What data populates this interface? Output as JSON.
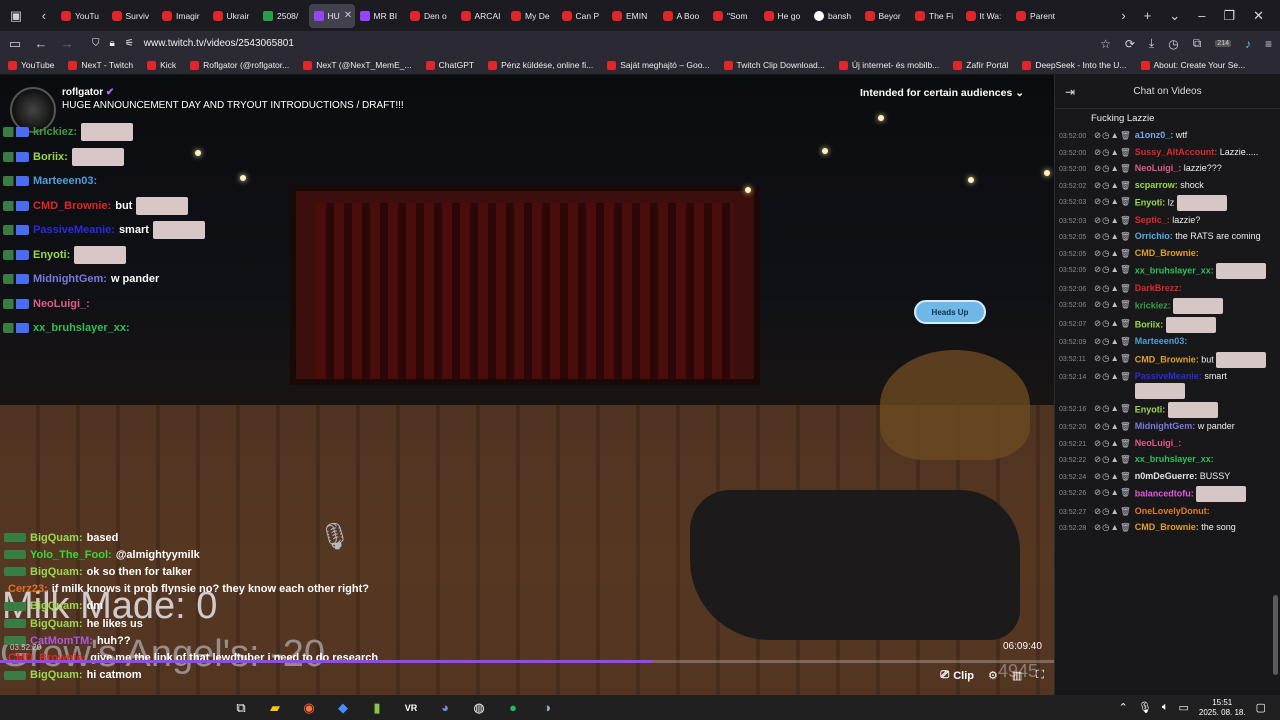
{
  "browser": {
    "tabs": [
      {
        "label": "YouTu",
        "icon": "youtube"
      },
      {
        "label": "Surviv",
        "icon": "youtube"
      },
      {
        "label": "Imagir",
        "icon": "youtube"
      },
      {
        "label": "Ukrair",
        "icon": "youtube"
      },
      {
        "label": "2508/",
        "icon": "sheet"
      },
      {
        "label": "HU",
        "icon": "twitch",
        "active": true
      },
      {
        "label": "MR BI",
        "icon": "twitch"
      },
      {
        "label": "Den o",
        "icon": "youtube"
      },
      {
        "label": "ARCAI",
        "icon": "youtube"
      },
      {
        "label": "My De",
        "icon": "youtube"
      },
      {
        "label": "Can P",
        "icon": "youtube"
      },
      {
        "label": "EMIN",
        "icon": "youtube"
      },
      {
        "label": "A Boo",
        "icon": "youtube"
      },
      {
        "label": "\"Som",
        "icon": "youtube"
      },
      {
        "label": "He go",
        "icon": "youtube"
      },
      {
        "label": "bansh",
        "icon": "google"
      },
      {
        "label": "Beyor",
        "icon": "youtube"
      },
      {
        "label": "The Fi",
        "icon": "youtube"
      },
      {
        "label": "It Wa:",
        "icon": "youtube"
      },
      {
        "label": "Parent",
        "icon": "youtube"
      }
    ],
    "url": "www.twitch.tv/videos/2543065801",
    "bookmarks": [
      "YouTube",
      "NexT - Twitch",
      "Kick",
      "Roflgator (@roflgator...",
      "NexT (@NexT_MemE_...",
      "ChatGPT",
      "Pénz küldése, online fi...",
      "Saját meghajtó – Goo...",
      "Twitch Clip Download...",
      "Új internet- és mobilb...",
      "Zafír Portál",
      "DeepSeek - Into the U...",
      "About: Create Your Se..."
    ],
    "extension_badge": "214"
  },
  "video": {
    "streamer": "roflgator",
    "title": "HUGE ANNOUNCEMENT DAY AND TRYOUT INTRODUCTIONS / DRAFT!!!",
    "audience_label": "Intended for certain audiences",
    "heads_up": "Heads Up",
    "time": "06:09:40",
    "clip_label": "Clip",
    "progress_fraction": 0.62,
    "overlay_text_1": "Milk Made: 0",
    "overlay_text_2": "Grow's Angel's: -20",
    "overlay_number": "4945",
    "overlay_chat": [
      {
        "user": "krickiez:",
        "color": "#3e9d3e",
        "text": "",
        "emote": true
      },
      {
        "user": "Boriix:",
        "color": "#9ad94f",
        "text": "",
        "emote": true
      },
      {
        "user": "Marteeen03:",
        "color": "#4f9fd9",
        "text": "",
        "emote": false
      },
      {
        "user": "CMD_Brownie:",
        "color": "#e0272a",
        "text": "but",
        "emote": true
      },
      {
        "user": "PassiveMeanie:",
        "color": "#2a2ae0",
        "text": "smart",
        "emote": true
      },
      {
        "user": "Enyoti:",
        "color": "#9ad94f",
        "text": "",
        "emote": true
      },
      {
        "user": "MidnightGem:",
        "color": "#7a7ae0",
        "text": "w pander",
        "emote": false
      },
      {
        "user": "NeoLuigi_:",
        "color": "#e05a8a",
        "text": "",
        "emote": false
      },
      {
        "user": "xx_bruhslayer_xx:",
        "color": "#2fbf5a",
        "text": "",
        "emote": false
      }
    ],
    "lower_chat": [
      {
        "user": "BigQuam:",
        "color": "#9ad94f",
        "text": "based"
      },
      {
        "user": "Yolo_The_Fool:",
        "color": "#3ad93a",
        "text": "@almightyymilk"
      },
      {
        "user": "BigQuam:",
        "color": "#9ad94f",
        "text": "ok so then for talker"
      },
      {
        "user": "Cerz23:",
        "color": "#e0702a",
        "text": "if milk knows it prob flynsie no? they know each other right?"
      },
      {
        "user": "BigQuam:",
        "color": "#9ad94f",
        "text": "dm"
      },
      {
        "user": "BigQuam:",
        "color": "#9ad94f",
        "text": "he likes us"
      },
      {
        "user": "CatMomTM:",
        "color": "#b05ae0",
        "text": "huh??"
      },
      {
        "user": "CMD_Brownie:",
        "color": "#e0272a",
        "text": "give me the link of that lewdtuber i need to do research"
      },
      {
        "user": "BigQuam:",
        "color": "#9ad94f",
        "text": "hi catmom"
      }
    ],
    "lower_timestamp": "03:52:20"
  },
  "chat": {
    "header": "Chat on Videos",
    "first_line": "Fucking Lazzie",
    "messages": [
      {
        "ts": "03:52:00",
        "user": "a1onz0_:",
        "color": "#7aa6e8",
        "text": "wtf",
        "emote": false
      },
      {
        "ts": "03:52:00",
        "user": "Sussy_AltAccount:",
        "color": "#e0272a",
        "text": "Lazzie.....",
        "emote": false
      },
      {
        "ts": "03:52:00",
        "user": "NeoLuigi_:",
        "color": "#e05a8a",
        "text": "lazzie???",
        "emote": false
      },
      {
        "ts": "03:52:02",
        "user": "scparrow:",
        "color": "#9ad94f",
        "text": "shock",
        "emote": false
      },
      {
        "ts": "03:52:03",
        "user": "Enyoti:",
        "color": "#9ad94f",
        "text": "lz",
        "emote": true
      },
      {
        "ts": "03:52:03",
        "user": "Septic_:",
        "color": "#e0272a",
        "text": "lazzie?",
        "emote": false
      },
      {
        "ts": "03:52:05",
        "user": "Orrichio:",
        "color": "#4fb0e8",
        "text": "the RATS are coming",
        "emote": false
      },
      {
        "ts": "03:52:05",
        "user": "CMD_Brownie:",
        "color": "#e0a02a",
        "text": "",
        "emote": false
      },
      {
        "ts": "03:52:05",
        "user": "xx_bruhslayer_xx:",
        "color": "#2fbf5a",
        "text": "",
        "emote": true
      },
      {
        "ts": "03:52:06",
        "user": "DarkBrezz:",
        "color": "#e0272a",
        "text": "",
        "emote": false
      },
      {
        "ts": "03:52:06",
        "user": "krickiez:",
        "color": "#3e9d3e",
        "text": "",
        "emote": true
      },
      {
        "ts": "03:52:07",
        "user": "Boriix:",
        "color": "#9ad94f",
        "text": "",
        "emote": true
      },
      {
        "ts": "03:52:09",
        "user": "Marteeen03:",
        "color": "#4f9fd9",
        "text": "",
        "emote": false
      },
      {
        "ts": "03:52:11",
        "user": "CMD_Brownie:",
        "color": "#e0a02a",
        "text": "but",
        "emote": true
      },
      {
        "ts": "03:52:14",
        "user": "PassiveMeanie:",
        "color": "#2a2ae0",
        "text": "smart",
        "emote": true
      },
      {
        "ts": "03:52:16",
        "user": "Enyoti:",
        "color": "#9ad94f",
        "text": "",
        "emote": true
      },
      {
        "ts": "03:52:20",
        "user": "MidnightGem:",
        "color": "#7a7ae0",
        "text": "w pander",
        "emote": false
      },
      {
        "ts": "03:52:21",
        "user": "NeoLuigi_:",
        "color": "#e05a8a",
        "text": "",
        "emote": false
      },
      {
        "ts": "03:52:22",
        "user": "xx_bruhslayer_xx:",
        "color": "#2fbf5a",
        "text": "",
        "emote": false
      },
      {
        "ts": "03:52:24",
        "user": "n0mDeGuerre:",
        "color": "#e6e6ea",
        "text": "BUSSY",
        "emote": false
      },
      {
        "ts": "03:52:26",
        "user": "balancedtofu:",
        "color": "#e05ae0",
        "text": "",
        "emote": true
      },
      {
        "ts": "03:52:27",
        "user": "OneLovelyDonut:",
        "color": "#e07a2a",
        "text": "",
        "emote": false
      },
      {
        "ts": "03:52:28",
        "user": "CMD_Brownie:",
        "color": "#e0a02a",
        "text": "the song",
        "emote": false
      }
    ]
  },
  "taskbar": {
    "time": "15:51",
    "date": "2025. 08. 18."
  }
}
